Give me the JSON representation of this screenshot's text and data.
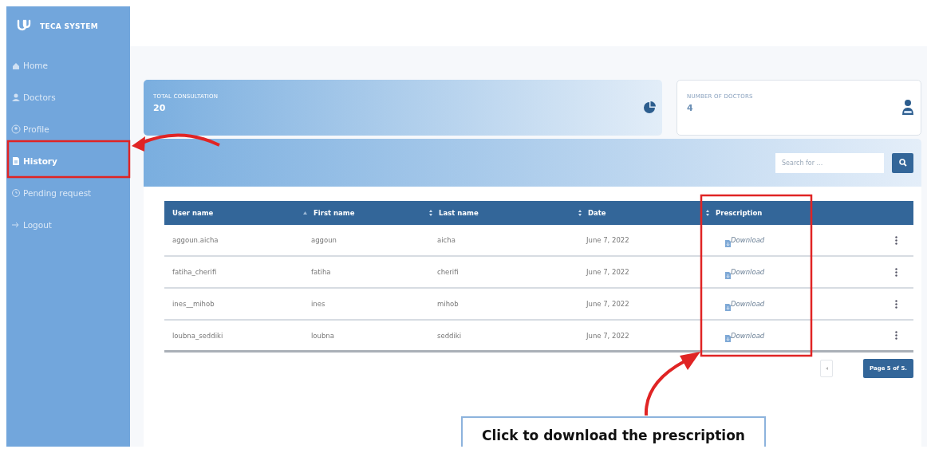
{
  "sidebar": {
    "brand": "TECA SYSTEM",
    "items": [
      {
        "label": "Home",
        "selected": false
      },
      {
        "label": "Doctors",
        "selected": false
      },
      {
        "label": "Profile",
        "selected": false
      },
      {
        "label": "History",
        "selected": true
      },
      {
        "label": "Pending request",
        "selected": false
      },
      {
        "label": "Logout",
        "selected": false
      }
    ]
  },
  "stats": [
    {
      "kind": "gradient",
      "label": "TOTAL CONSULTATION",
      "value": "20"
    },
    {
      "kind": "plain",
      "label": "NUMBER OF DOCTORS",
      "value": "4"
    }
  ],
  "search": {
    "placeholder": "Search for ..."
  },
  "table": {
    "columns": [
      {
        "label": "User name"
      },
      {
        "label": "First name"
      },
      {
        "label": "Last name"
      },
      {
        "label": "Date"
      },
      {
        "label": "Prescription"
      }
    ],
    "rows": [
      {
        "cells": [
          "aggoun.aicha",
          "aggoun",
          "aicha",
          "June 7, 2022"
        ],
        "action": "Download"
      },
      {
        "cells": [
          "fatiha_cherifi",
          "fatiha",
          "cherifi",
          "June 7, 2022"
        ],
        "action": "Download"
      },
      {
        "cells": [
          "ines__mihob",
          "ines",
          "mihob",
          "June 7, 2022"
        ],
        "action": "Download"
      },
      {
        "cells": [
          "loubna_seddiki",
          "loubna",
          "seddiki",
          "June 7, 2022"
        ],
        "action": "Download"
      }
    ]
  },
  "pagination": {
    "page": "Page 5 of 5."
  },
  "annotation": {
    "callout": "Click to download the prescription"
  }
}
